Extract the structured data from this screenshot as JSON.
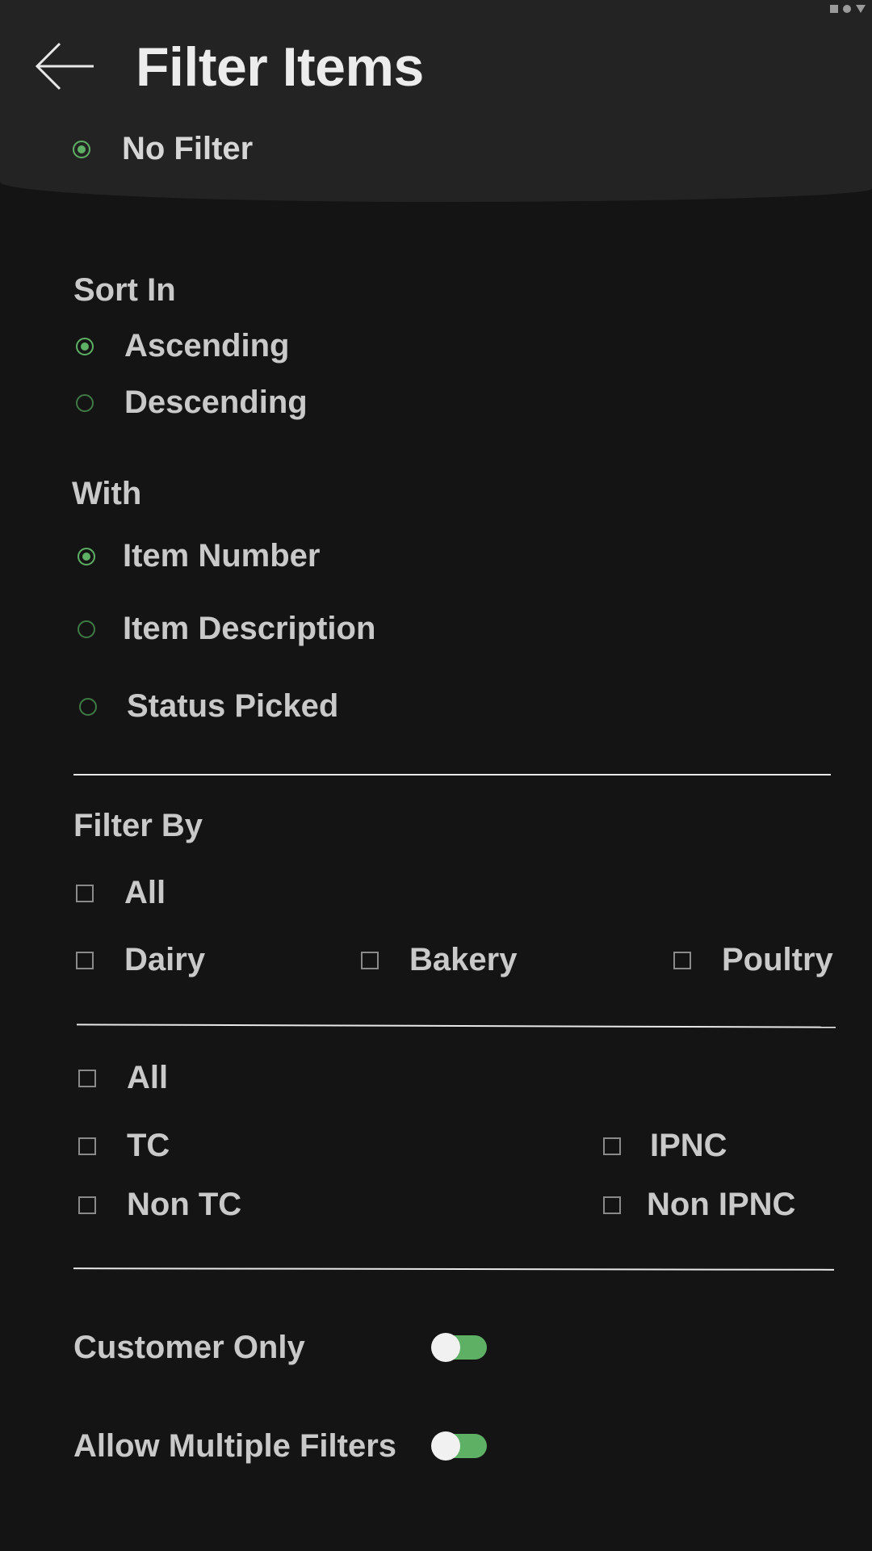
{
  "header": {
    "title": "Filter Items"
  },
  "top_option": {
    "label": "No Filter",
    "selected": true
  },
  "sort": {
    "heading": "Sort In",
    "options": [
      {
        "label": "Ascending",
        "selected": true
      },
      {
        "label": "Descending",
        "selected": false
      }
    ]
  },
  "with": {
    "heading": "With",
    "options": [
      {
        "label": "Item Number",
        "selected": true
      },
      {
        "label": "Item Description",
        "selected": false
      },
      {
        "label": "Status Picked",
        "selected": false
      }
    ]
  },
  "filter_by": {
    "heading": "Filter By",
    "group1": {
      "all": "All",
      "items": [
        "Dairy",
        "Bakery",
        "Poultry"
      ]
    },
    "group2": {
      "all": "All",
      "tc": "TC",
      "ipnc": "IPNC",
      "non_tc": "Non TC",
      "non_ipnc": "Non IPNC"
    }
  },
  "toggles": {
    "customer_only": {
      "label": "Customer Only",
      "on": true
    },
    "allow_multiple": {
      "label": "Allow Multiple Filters",
      "on": true
    }
  },
  "colors": {
    "accent": "#5db064",
    "background": "#141414",
    "header": "#232323"
  }
}
